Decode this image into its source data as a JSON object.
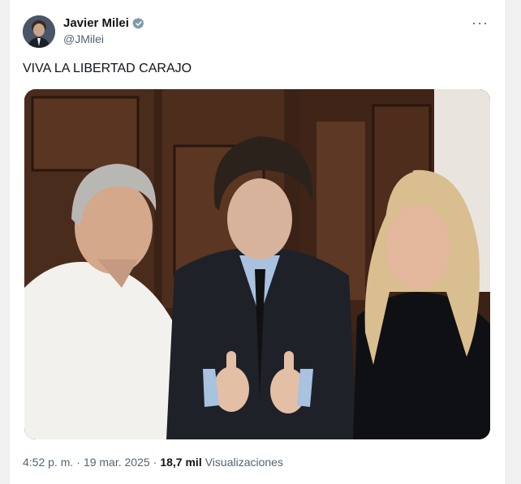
{
  "author": {
    "name": "Javier Milei",
    "handle": "@JMilei"
  },
  "tweet": {
    "text": "VIVA LA LIBERTAD CARAJO"
  },
  "more_button": "···",
  "meta": {
    "time": "4:52 p. m.",
    "sep1": "·",
    "date": "19 mar. 2025",
    "sep2": "·",
    "views_count": "18,7 mil",
    "views_label": "Visualizaciones"
  },
  "colors": {
    "verified_badge": "#829aab",
    "text_primary": "#0f1419",
    "text_secondary": "#536471"
  },
  "icons": [
    "verified-badge-icon",
    "more-options-icon"
  ]
}
